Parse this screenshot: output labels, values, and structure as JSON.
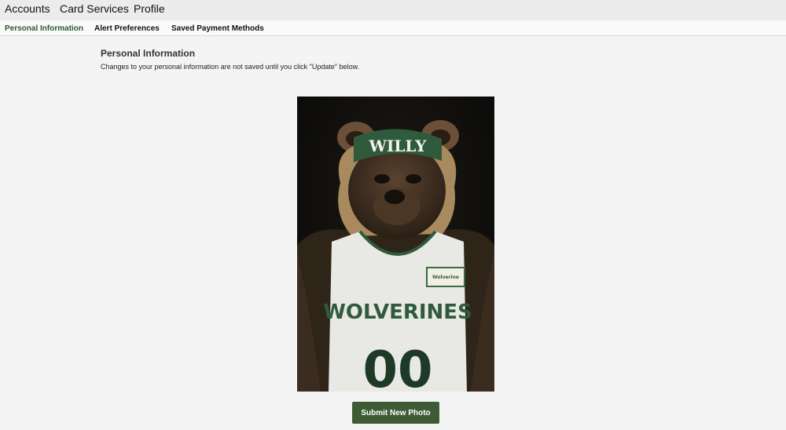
{
  "top_nav": {
    "items": [
      {
        "label": "Accounts"
      },
      {
        "label": "Card Services"
      },
      {
        "label": "Profile"
      }
    ]
  },
  "sub_nav": {
    "items": [
      {
        "label": "Personal Information",
        "active": true
      },
      {
        "label": "Alert Preferences",
        "active": false
      },
      {
        "label": "Saved Payment Methods",
        "active": false
      }
    ]
  },
  "main": {
    "title": "Personal Information",
    "description": "Changes to your personal information are not saved until you click \"Update\" below.",
    "photo": {
      "subject": "mascot-photo",
      "headband_text": "WILLY",
      "jersey_text": "WOLVERINES",
      "jersey_number": "00",
      "patch_text": "Wolverine"
    },
    "submit_button_label": "Submit New Photo"
  },
  "colors": {
    "accent": "#3d5c36",
    "active_tab": "#2e5a37",
    "topnav_bg": "#ececec",
    "page_bg": "#f4f4f4"
  }
}
